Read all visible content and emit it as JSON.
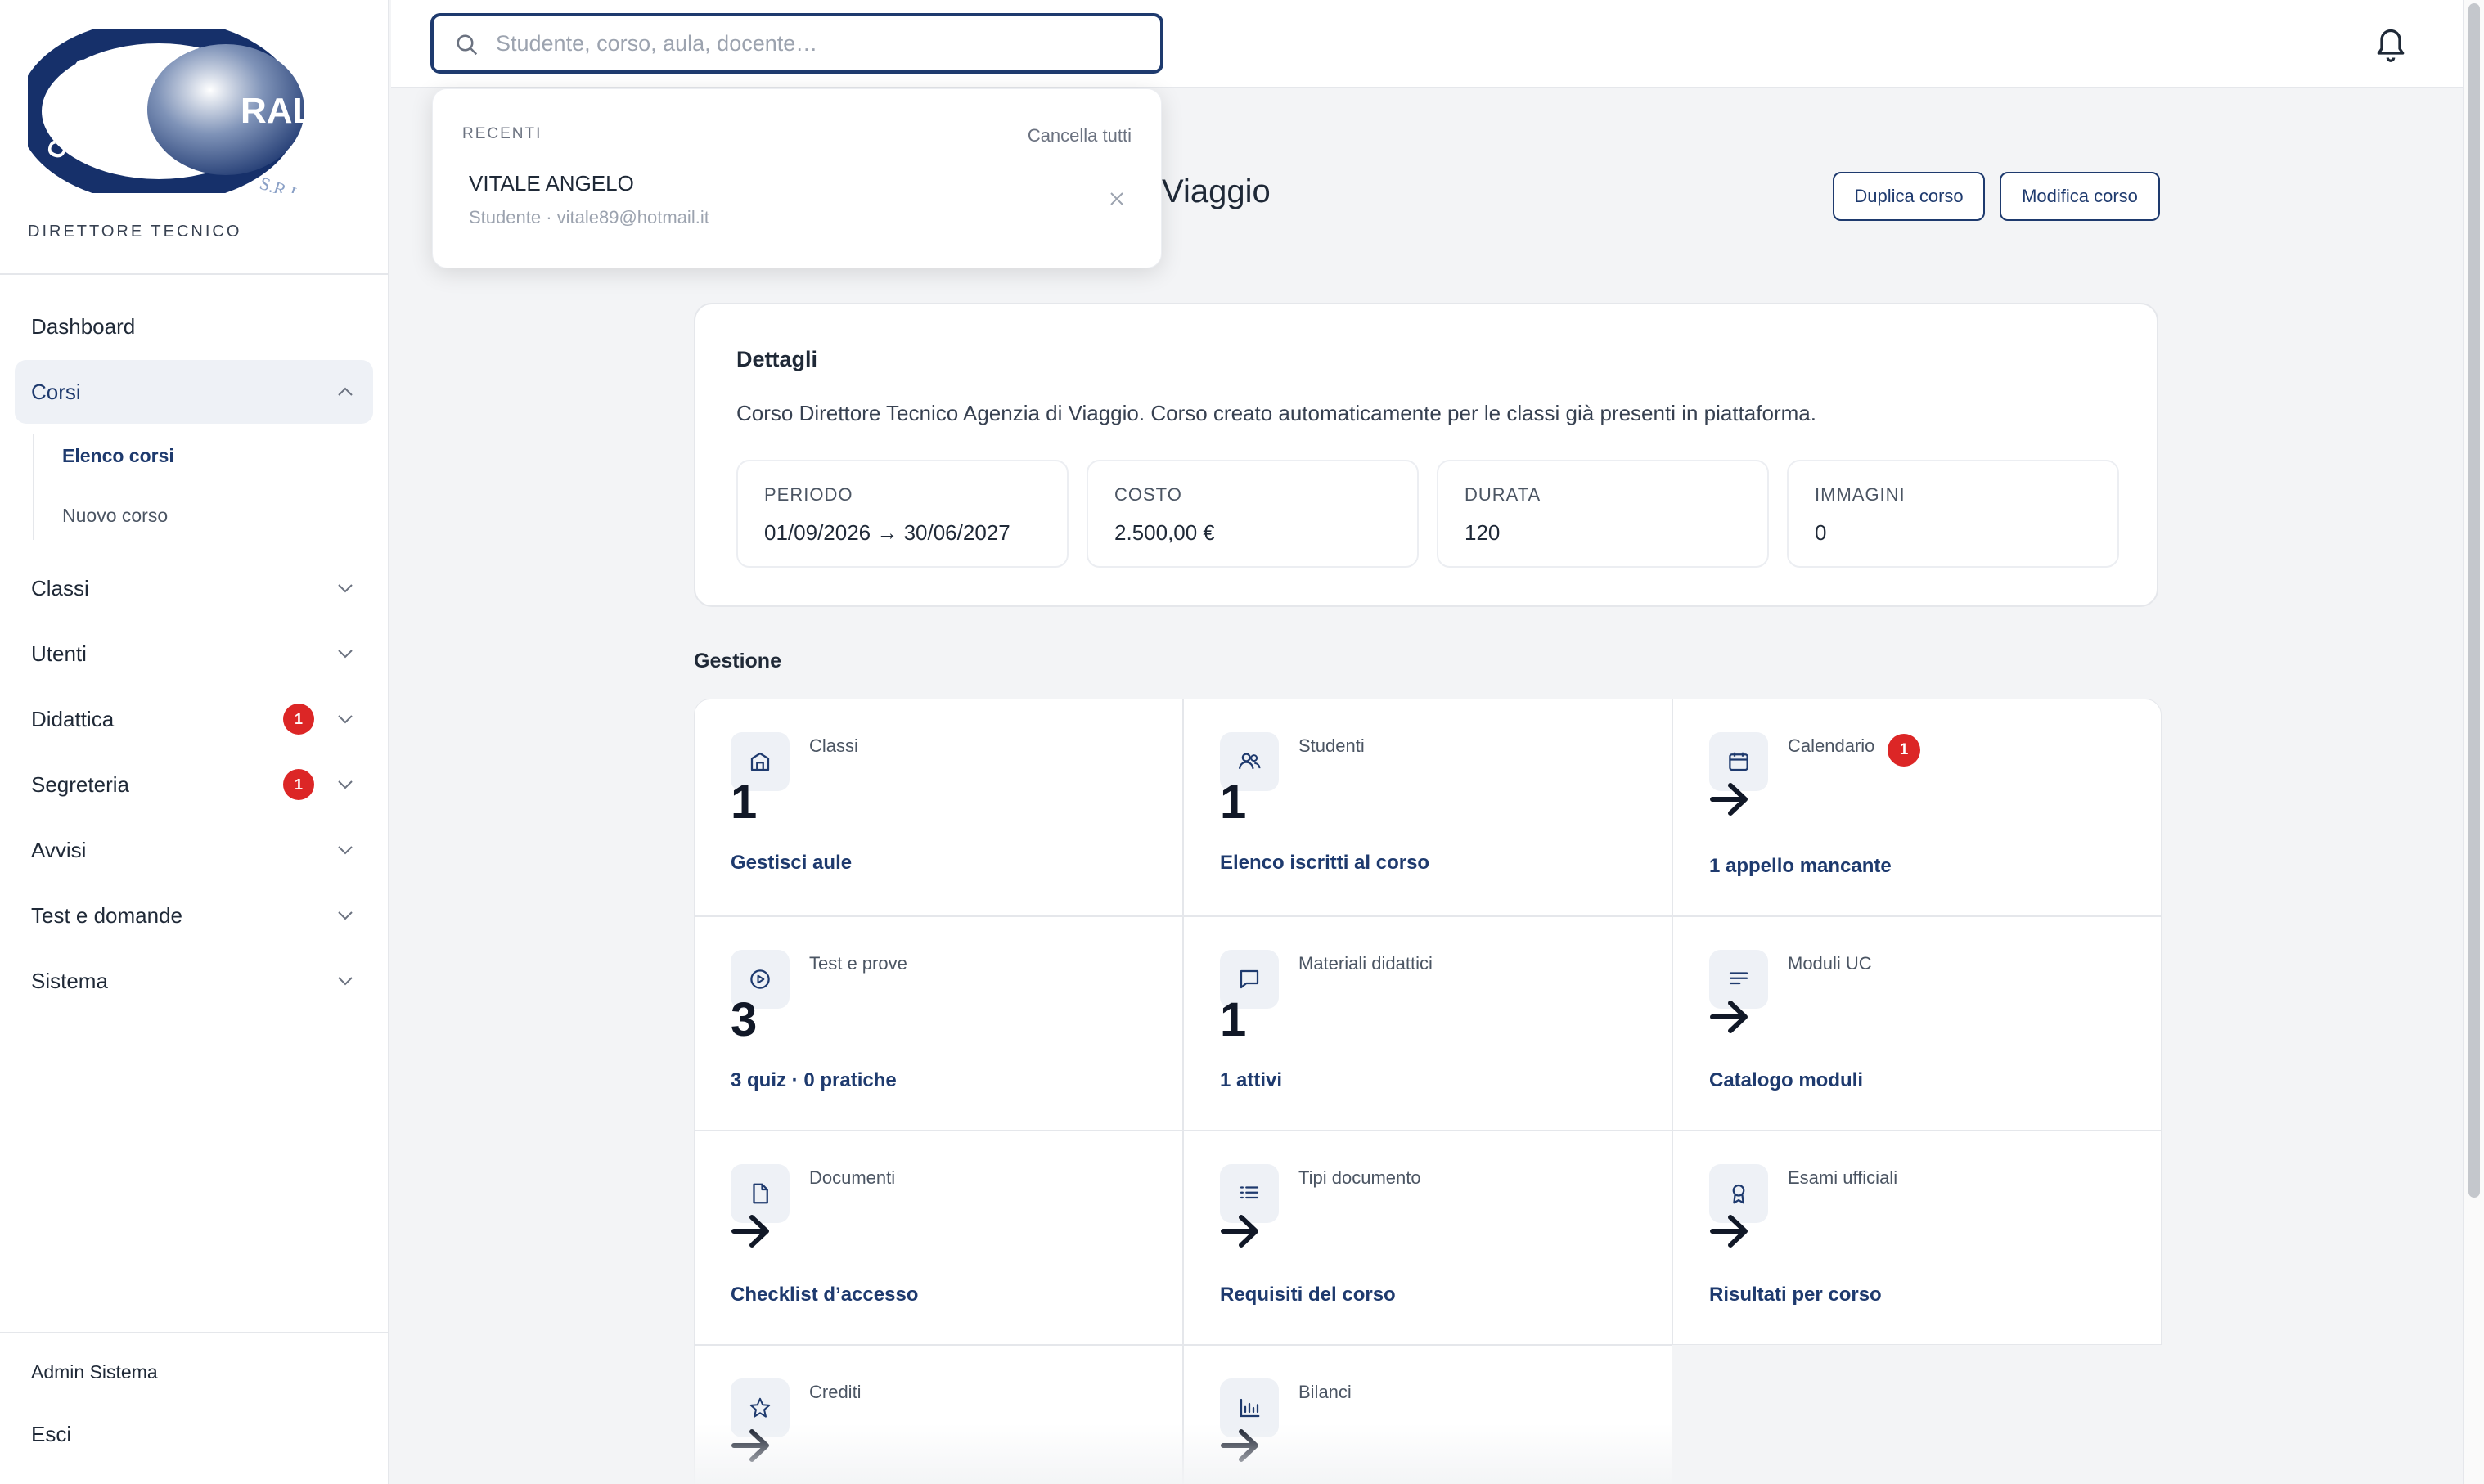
{
  "sidebar": {
    "logo_text": "RAL",
    "logo_arc_text": "CENTRO",
    "logo_srl": "S.R.L.",
    "role": "DIRETTORE TECNICO",
    "items": [
      {
        "label": "Dashboard"
      },
      {
        "label": "Corsi"
      },
      {
        "label": "Classi"
      },
      {
        "label": "Utenti"
      },
      {
        "label": "Didattica",
        "badge": "1"
      },
      {
        "label": "Segreteria",
        "badge": "1"
      },
      {
        "label": "Avvisi"
      },
      {
        "label": "Test e domande"
      },
      {
        "label": "Sistema"
      }
    ],
    "sub_items": [
      {
        "label": "Elenco corsi"
      },
      {
        "label": "Nuovo corso"
      }
    ],
    "footer": {
      "admin": "Admin Sistema",
      "logout": "Esci"
    }
  },
  "search": {
    "placeholder": "Studente, corso, aula, docente…",
    "value": ""
  },
  "dropdown": {
    "heading": "RECENTI",
    "clear_label": "Cancella tutti",
    "items": [
      {
        "name": "VITALE ANGELO",
        "detail": "Studente · vitale89@hotmail.it"
      }
    ]
  },
  "header": {
    "title_visible": "i Viaggio",
    "duplicate_label": "Duplica corso",
    "edit_label": "Modifica corso"
  },
  "details": {
    "title": "Dettagli",
    "description": "Corso Direttore Tecnico Agenzia di Viaggio. Corso creato automaticamente per le classi già presenti in piattaforma.",
    "stats": [
      {
        "label": "PERIODO",
        "value": "01/09/2026 → 30/06/2027"
      },
      {
        "label": "COSTO",
        "value": "2.500,00 €"
      },
      {
        "label": "DURATA",
        "value": "120"
      },
      {
        "label": "IMMAGINI",
        "value": "0"
      }
    ]
  },
  "gestione": {
    "title": "Gestione",
    "tiles": [
      {
        "label": "Classi",
        "value": "1",
        "link": "Gestisci aule",
        "icon": "building-icon"
      },
      {
        "label": "Studenti",
        "value": "1",
        "link": "Elenco iscritti al corso",
        "icon": "users-icon"
      },
      {
        "label": "Calendario",
        "badge": "1",
        "link": "1 appello mancante",
        "icon": "calendar-icon"
      },
      {
        "label": "Test e prove",
        "value": "3",
        "link": "3 quiz · 0 pratiche",
        "icon": "play-circle-icon"
      },
      {
        "label": "Materiali didattici",
        "value": "1",
        "link": "1 attivi",
        "icon": "message-square-icon"
      },
      {
        "label": "Moduli UC",
        "link": "Catalogo moduli",
        "icon": "text-lines-icon"
      },
      {
        "label": "Documenti",
        "link": "Checklist d’accesso",
        "icon": "file-icon"
      },
      {
        "label": "Tipi documento",
        "link": "Requisiti del corso",
        "icon": "list-icon"
      },
      {
        "label": "Esami ufficiali",
        "link": "Risultati per corso",
        "icon": "award-icon"
      },
      {
        "label": "Crediti",
        "link": "",
        "icon": "star-icon"
      },
      {
        "label": "Bilanci",
        "link": "",
        "icon": "bar-chart-icon"
      }
    ]
  },
  "colors": {
    "brand": "#1e3a6e",
    "badge": "#dc2626",
    "background": "#f3f4f6"
  }
}
